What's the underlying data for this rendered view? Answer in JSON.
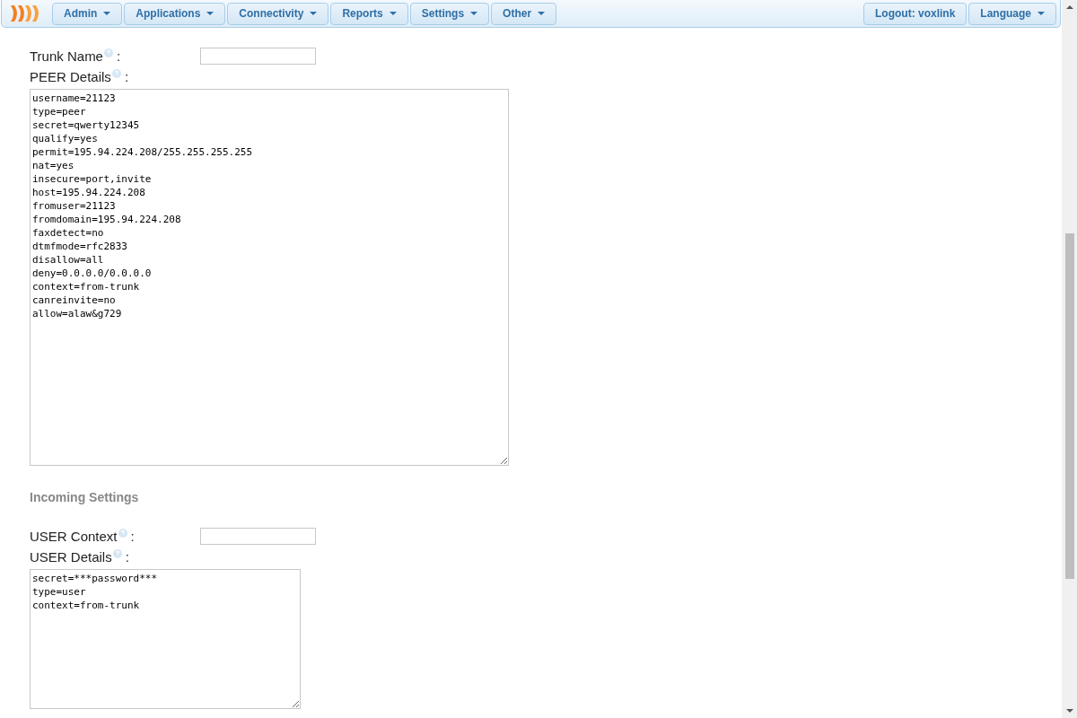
{
  "nav": {
    "menus": [
      {
        "label": "Admin",
        "caret": true
      },
      {
        "label": "Applications",
        "caret": true
      },
      {
        "label": "Connectivity",
        "caret": true
      },
      {
        "label": "Reports",
        "caret": true
      },
      {
        "label": "Settings",
        "caret": true
      },
      {
        "label": "Other",
        "caret": true
      }
    ],
    "right": [
      {
        "label": "Logout: voxlink",
        "caret": false
      },
      {
        "label": "Language",
        "caret": true
      }
    ]
  },
  "trunk_name": {
    "label": "Trunk Name",
    "colon": ":"
  },
  "peer_details": {
    "label": "PEER Details",
    "colon": ":",
    "value": "username=21123\ntype=peer\nsecret=qwerty12345\nqualify=yes\npermit=195.94.224.208/255.255.255.255\nnat=yes\ninsecure=port,invite\nhost=195.94.224.208\nfromuser=21123\nfromdomain=195.94.224.208\nfaxdetect=no\ndtmfmode=rfc2833\ndisallow=all\ndeny=0.0.0.0/0.0.0.0\ncontext=from-trunk\ncanreinvite=no\nallow=alaw&g729"
  },
  "incoming_heading": "Incoming Settings",
  "user_context": {
    "label": "USER Context",
    "colon": ":"
  },
  "user_details": {
    "label": "USER Details",
    "colon": ":",
    "value": "secret=***password***\ntype=user\ncontext=from-trunk"
  }
}
